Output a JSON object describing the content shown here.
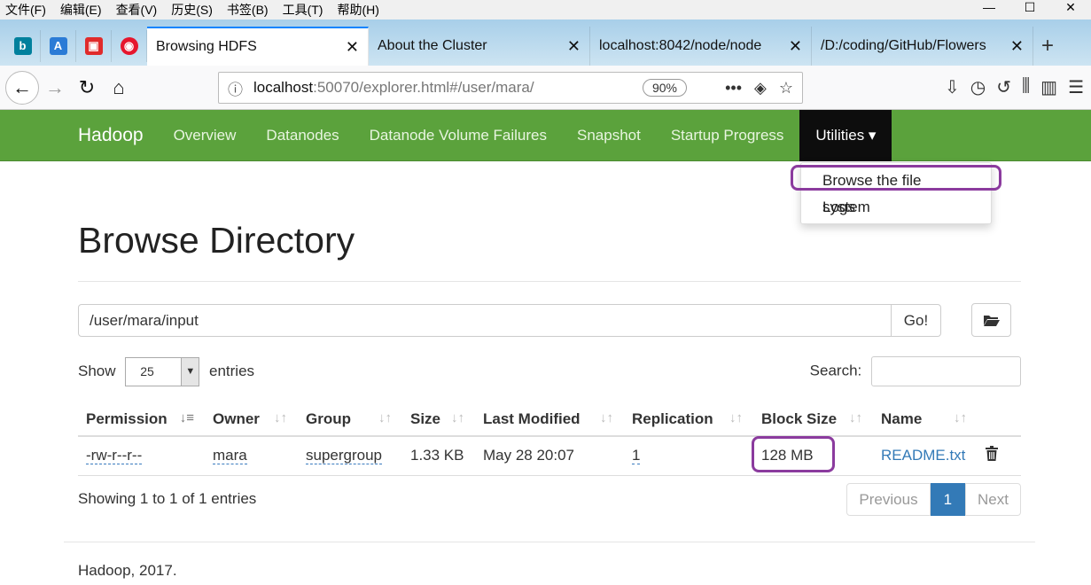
{
  "menubar": {
    "items": [
      "文件(F)",
      "编辑(E)",
      "查看(V)",
      "历史(S)",
      "书签(B)",
      "工具(T)",
      "帮助(H)"
    ]
  },
  "window_controls": {
    "minimize": "—",
    "maximize": "☐",
    "close": "✕"
  },
  "tabs": [
    {
      "label": "Browsing HDFS",
      "active": true
    },
    {
      "label": "About the Cluster",
      "active": false
    },
    {
      "label": "localhost:8042/node/node",
      "active": false
    },
    {
      "label": "/D:/coding/GitHub/Flowers",
      "active": false
    }
  ],
  "tab_close": "✕",
  "new_tab": "+",
  "pinned_tabs": [
    {
      "icon": "bing-icon",
      "glyph": "b",
      "color": "#00809d"
    },
    {
      "icon": "dictionary-icon",
      "glyph": "A",
      "color": "#2b7bd6"
    },
    {
      "icon": "app-icon",
      "glyph": "▣",
      "color": "#e02b2b"
    },
    {
      "icon": "weibo-icon",
      "glyph": "◉",
      "color": "#e6162d"
    }
  ],
  "address": {
    "host": "localhost",
    "rest": ":50070/explorer.html#/user/mara/",
    "zoom": "90%"
  },
  "hadoop_nav": {
    "brand": "Hadoop",
    "links": [
      "Overview",
      "Datanodes",
      "Datanode Volume Failures",
      "Snapshot",
      "Startup Progress"
    ],
    "utilities": "Utilities ▾"
  },
  "utilities_menu": [
    "Browse the file system",
    "Logs"
  ],
  "page": {
    "title": "Browse Directory",
    "path": "/user/mara/input",
    "go": "Go!",
    "show_label": "Show",
    "entries_value": "25",
    "entries_label": "entries",
    "search_label": "Search:"
  },
  "table": {
    "headers": [
      "Permission",
      "Owner",
      "Group",
      "Size",
      "Last Modified",
      "Replication",
      "Block Size",
      "Name"
    ],
    "rows": [
      {
        "permission": "-rw-r--r--",
        "owner": "mara",
        "group": "supergroup",
        "size": "1.33 KB",
        "modified": "May 28 20:07",
        "replication": "1",
        "block_size": "128 MB",
        "name": "README.txt"
      }
    ]
  },
  "pagination": {
    "info": "Showing 1 to 1 of 1 entries",
    "previous": "Previous",
    "current": "1",
    "next": "Next"
  },
  "footer": "Hadoop, 2017.",
  "colors": {
    "navbar": "#5ba23c",
    "highlight": "#8b3b9e",
    "link": "#337ab7"
  }
}
